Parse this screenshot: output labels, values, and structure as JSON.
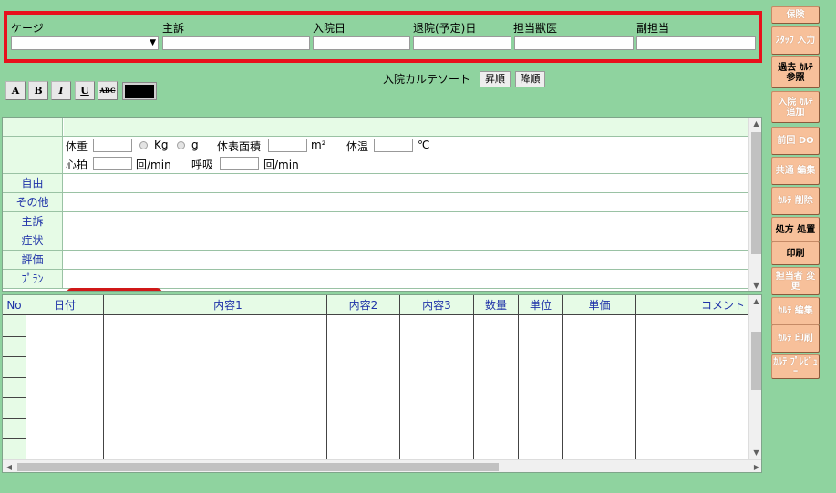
{
  "header": {
    "cage_label": "ケージ",
    "complaint_label": "主訴",
    "admission_label": "入院日",
    "discharge_label": "退院(予定)日",
    "doctor_label": "担当獣医",
    "sub_doctor_label": "副担当",
    "cage_value": "",
    "complaint_value": "",
    "admission_value": "",
    "discharge_value": "",
    "doctor_value": "",
    "sub_doctor_value": ""
  },
  "toolbar": {
    "font_a": "A",
    "bold": "B",
    "italic": "I",
    "underline": "U",
    "strike": "ABC",
    "color": "#000000"
  },
  "sort": {
    "label": "入院カルテソート",
    "asc": "昇順",
    "desc": "降順"
  },
  "vitals": {
    "weight_label": "体重",
    "kg": "Kg",
    "g": "g",
    "bsa_label": "体表面積",
    "bsa_unit": "m²",
    "temp_label": "体温",
    "temp_unit": "℃",
    "pulse_label": "心拍",
    "pulse_unit": "回/min",
    "resp_label": "呼吸",
    "resp_unit": "回/min"
  },
  "karte_rows": [
    {
      "label": "自由"
    },
    {
      "label": "その他"
    },
    {
      "label": "主訴"
    },
    {
      "label": "症状"
    },
    {
      "label": "評価"
    },
    {
      "label": "ﾌﾟﾗﾝ"
    }
  ],
  "grid": {
    "columns": [
      "No",
      "日付",
      "",
      "内容1",
      "内容2",
      "内容3",
      "数量",
      "単位",
      "単価",
      "コメント"
    ]
  },
  "side_buttons": [
    {
      "label": "保険",
      "active": false
    },
    {
      "label": "ｽﾀｯﾌ 入力",
      "active": false
    },
    {
      "label": "過去 ｶﾙﾃ 参照",
      "active": true
    },
    {
      "label": "入院 ｶﾙﾃ 追加",
      "active": false
    },
    {
      "label": "前回 DO",
      "active": false
    },
    {
      "label": "共通 編集",
      "active": false
    },
    {
      "label": "ｶﾙﾃ 削除",
      "active": false
    },
    {
      "label": "処方 処置",
      "active": true
    },
    {
      "label": "印刷",
      "active": true
    },
    {
      "label": "担当者 変更",
      "active": false
    },
    {
      "label": "ｶﾙﾃ 編集",
      "active": false
    },
    {
      "label": "ｶﾙﾃ 印刷",
      "active": false
    },
    {
      "label": "ｶﾙﾃ ﾌﾟﾚﾋﾞｭｰ",
      "active": false
    }
  ]
}
